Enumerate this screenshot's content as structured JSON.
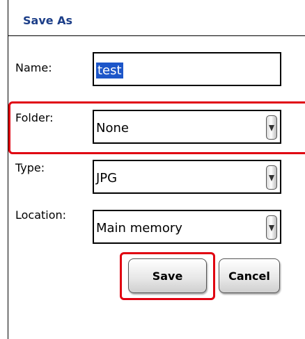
{
  "dialog": {
    "title": "Save As"
  },
  "fields": {
    "name": {
      "label": "Name:",
      "value": "test"
    },
    "folder": {
      "label": "Folder:",
      "value": "None"
    },
    "type": {
      "label": "Type:",
      "value": "JPG"
    },
    "location": {
      "label": "Location:",
      "value": "Main memory"
    }
  },
  "buttons": {
    "save": "Save",
    "cancel": "Cancel"
  },
  "colors": {
    "title": "#1c3e88",
    "highlight": "#e00010",
    "selection": "#1d56c9"
  }
}
